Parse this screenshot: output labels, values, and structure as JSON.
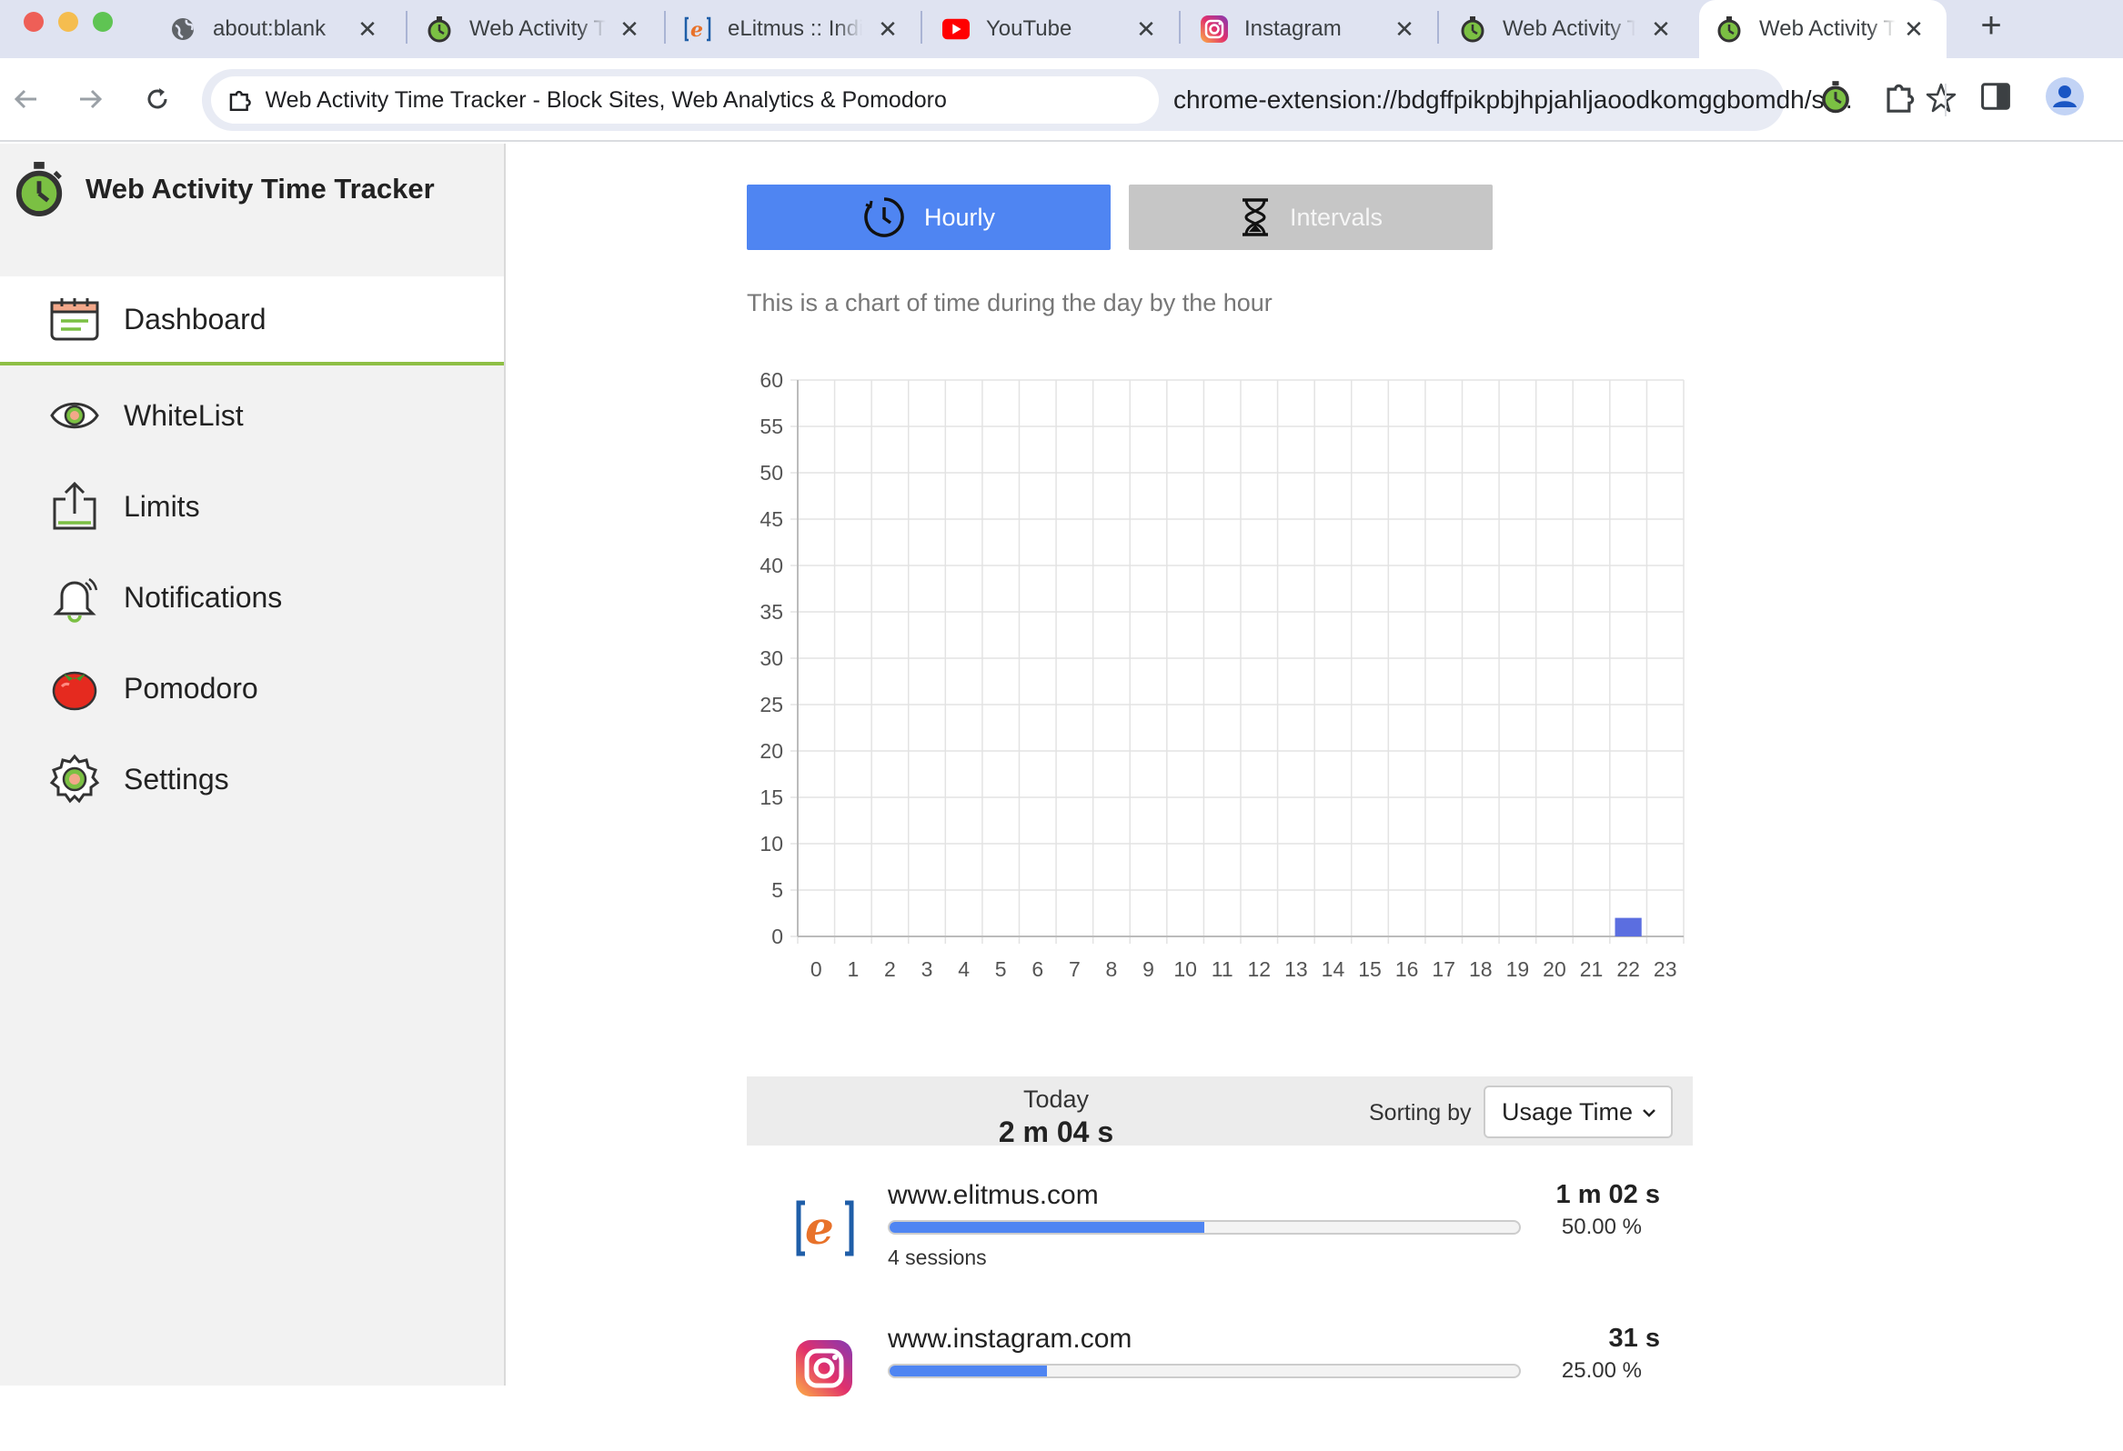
{
  "browser": {
    "tabs": [
      {
        "title": "about:blank",
        "icon": "globe-icon"
      },
      {
        "title": "Web Activity Time Tracker",
        "icon": "stopwatch-icon"
      },
      {
        "title": "eLitmus :: India",
        "icon": "elitmus-icon"
      },
      {
        "title": "YouTube",
        "icon": "youtube-icon"
      },
      {
        "title": "Instagram",
        "icon": "instagram-icon"
      },
      {
        "title": "Web Activity Time Tracker",
        "icon": "stopwatch-icon"
      },
      {
        "title": "Web Activity Time Tracker",
        "icon": "stopwatch-icon",
        "active": true
      }
    ],
    "chip_title": "Web Activity Time Tracker - Block Sites, Web Analytics & Pomodoro",
    "url": "chrome-extension://bdgffpikpbjhpjahljaoodkomggbomdh/sr..."
  },
  "app": {
    "name": "Web Activity Time Tracker",
    "menu": [
      {
        "label": "Dashboard",
        "icon": "dashboard-icon",
        "active": true
      },
      {
        "label": "WhiteList",
        "icon": "eye-icon"
      },
      {
        "label": "Limits",
        "icon": "upload-icon"
      },
      {
        "label": "Notifications",
        "icon": "bell-icon"
      },
      {
        "label": "Pomodoro",
        "icon": "tomato-icon"
      },
      {
        "label": "Settings",
        "icon": "gear-icon"
      }
    ]
  },
  "dashboard": {
    "buttons": {
      "hourly": "Hourly",
      "intervals": "Intervals"
    },
    "caption": "This is a chart of time during the day by the hour",
    "summary": {
      "label": "Today",
      "total": "2 m 04 s",
      "sort_label": "Sorting by",
      "sort_value": "Usage Time"
    },
    "sites": [
      {
        "name": "www.elitmus.com",
        "time": "1 m 02 s",
        "percent_text": "50.00 %",
        "percent": 50,
        "sessions": "4 sessions",
        "icon": "elitmus-icon"
      },
      {
        "name": "www.instagram.com",
        "time": "31 s",
        "percent_text": "25.00 %",
        "percent": 25,
        "sessions": "",
        "icon": "instagram-icon"
      }
    ]
  },
  "chart_data": {
    "type": "bar",
    "title": "",
    "xlabel": "",
    "ylabel": "",
    "categories": [
      "0",
      "1",
      "2",
      "3",
      "4",
      "5",
      "6",
      "7",
      "8",
      "9",
      "10",
      "11",
      "12",
      "13",
      "14",
      "15",
      "16",
      "17",
      "18",
      "19",
      "20",
      "21",
      "22",
      "23"
    ],
    "values": [
      0,
      0,
      0,
      0,
      0,
      0,
      0,
      0,
      0,
      0,
      0,
      0,
      0,
      0,
      0,
      0,
      0,
      0,
      0,
      0,
      0,
      0,
      2,
      0
    ],
    "yticks": [
      "0",
      "5",
      "10",
      "15",
      "20",
      "25",
      "30",
      "35",
      "40",
      "45",
      "50",
      "55",
      "60"
    ],
    "ylim": [
      0,
      60
    ],
    "grid": true,
    "bar_color": "#5b6ee0"
  }
}
